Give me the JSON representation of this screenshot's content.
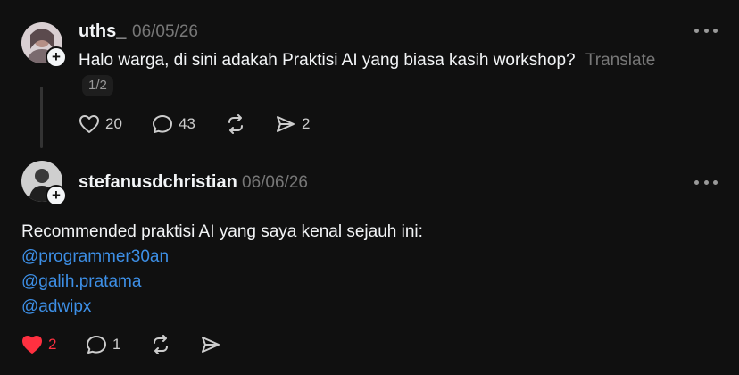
{
  "post1": {
    "username": "uths_",
    "date": "06/05/26",
    "text": "Halo warga, di sini adakah Praktisi AI yang biasa kasih workshop?",
    "translate_label": "Translate",
    "pager": "1/2",
    "actions": {
      "likes": "20",
      "replies": "43",
      "shares": "2"
    }
  },
  "post2": {
    "username": "stefanusdchristian",
    "date": "06/06/26",
    "text": "Recommended praktisi AI yang saya kenal sejauh ini:",
    "mentions": [
      "@programmer30an",
      "@galih.pratama",
      "@adwipx"
    ],
    "actions": {
      "likes": "2",
      "replies": "1"
    },
    "liked": true
  },
  "colors": {
    "background": "#101010",
    "like": "#ff3040",
    "mention": "#3d8fe6",
    "muted": "#777777"
  },
  "icons": [
    "plus-icon",
    "more-icon",
    "heart-icon",
    "comment-icon",
    "repost-icon",
    "share-icon"
  ]
}
